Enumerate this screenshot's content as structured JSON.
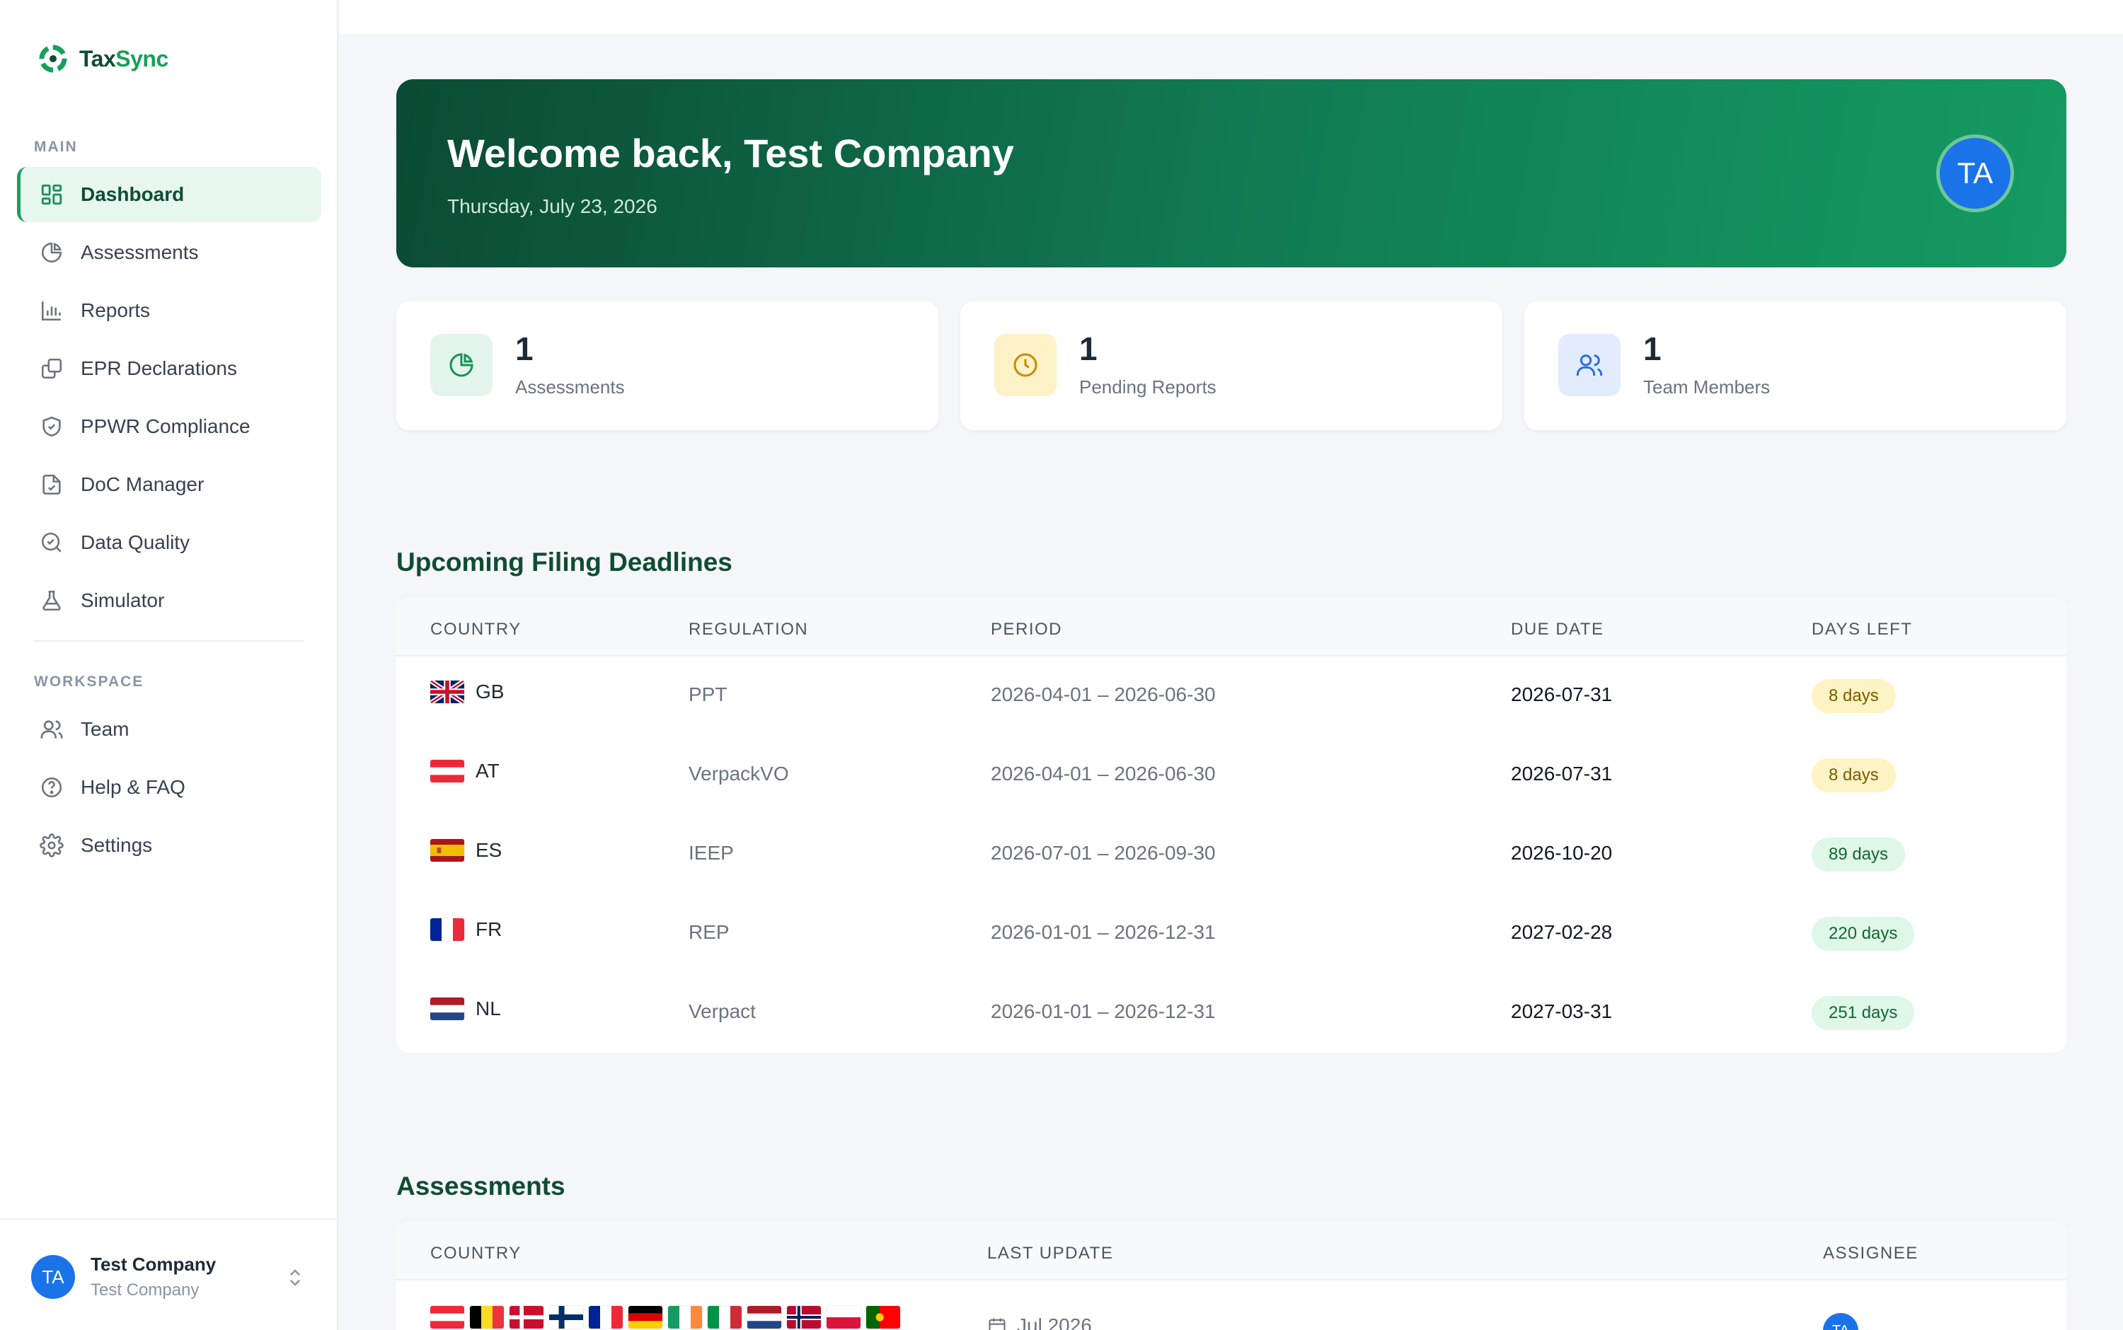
{
  "app": {
    "brand_part1": "Tax",
    "brand_part2": "Sync",
    "accent": "#18a058"
  },
  "sidebar": {
    "main_label": "MAIN",
    "workspace_label": "WORKSPACE",
    "main_items": [
      {
        "label": "Dashboard",
        "icon": "grid-icon",
        "active": true
      },
      {
        "label": "Assessments",
        "icon": "pie-chart-icon"
      },
      {
        "label": "Reports",
        "icon": "bar-chart-icon"
      },
      {
        "label": "EPR Declarations",
        "icon": "documents-icon"
      },
      {
        "label": "PPWR Compliance",
        "icon": "shield-check-icon"
      },
      {
        "label": "DoC Manager",
        "icon": "file-check-icon"
      },
      {
        "label": "Data Quality",
        "icon": "search-check-icon"
      },
      {
        "label": "Simulator",
        "icon": "flask-icon"
      }
    ],
    "workspace_items": [
      {
        "label": "Team",
        "icon": "users-icon"
      },
      {
        "label": "Help & FAQ",
        "icon": "help-circle-icon"
      },
      {
        "label": "Settings",
        "icon": "gear-icon"
      }
    ],
    "user": {
      "initials": "TA",
      "name": "Test Company",
      "company": "Test Company"
    }
  },
  "hero": {
    "title": "Welcome back, Test Company",
    "date": "Thursday, July 23, 2026",
    "avatar_initials": "TA"
  },
  "stats": [
    {
      "value": "1",
      "label": "Assessments",
      "icon": "pie-chart-icon",
      "color": "#16915a",
      "bg": "#e3f5ea"
    },
    {
      "value": "1",
      "label": "Pending Reports",
      "icon": "clock-icon",
      "color": "#c98a00",
      "bg": "#fdf1c7"
    },
    {
      "value": "1",
      "label": "Team Members",
      "icon": "users-icon",
      "color": "#2f6fe0",
      "bg": "#e2ecfd"
    }
  ],
  "deadlines": {
    "title": "Upcoming Filing Deadlines",
    "headers": {
      "country": "COUNTRY",
      "regulation": "REGULATION",
      "period": "PERIOD",
      "due": "DUE DATE",
      "days": "DAYS LEFT"
    },
    "rows": [
      {
        "country": "GB",
        "regulation": "PPT",
        "period": "2026-04-01 – 2026-06-30",
        "due": "2026-07-31",
        "days": "8 days",
        "status": "warn"
      },
      {
        "country": "AT",
        "regulation": "VerpackVO",
        "period": "2026-04-01 – 2026-06-30",
        "due": "2026-07-31",
        "days": "8 days",
        "status": "warn"
      },
      {
        "country": "ES",
        "regulation": "IEEP",
        "period": "2026-07-01 – 2026-09-30",
        "due": "2026-10-20",
        "days": "89 days",
        "status": "ok"
      },
      {
        "country": "FR",
        "regulation": "REP",
        "period": "2026-01-01 – 2026-12-31",
        "due": "2027-02-28",
        "days": "220 days",
        "status": "ok"
      },
      {
        "country": "NL",
        "regulation": "Verpact",
        "period": "2026-01-01 – 2026-12-31",
        "due": "2027-03-31",
        "days": "251 days",
        "status": "ok"
      }
    ]
  },
  "assessments": {
    "title": "Assessments",
    "headers": {
      "country": "COUNTRY",
      "last_update": "LAST UPDATE",
      "assignee": "ASSIGNEE"
    },
    "rows": [
      {
        "flags": [
          "AT",
          "BE",
          "DK",
          "FI",
          "FR",
          "DE",
          "IE",
          "IT",
          "NL",
          "NO",
          "PL",
          "PT"
        ],
        "last_update": "Jul 2026",
        "assignee_initials": "TA"
      }
    ]
  }
}
